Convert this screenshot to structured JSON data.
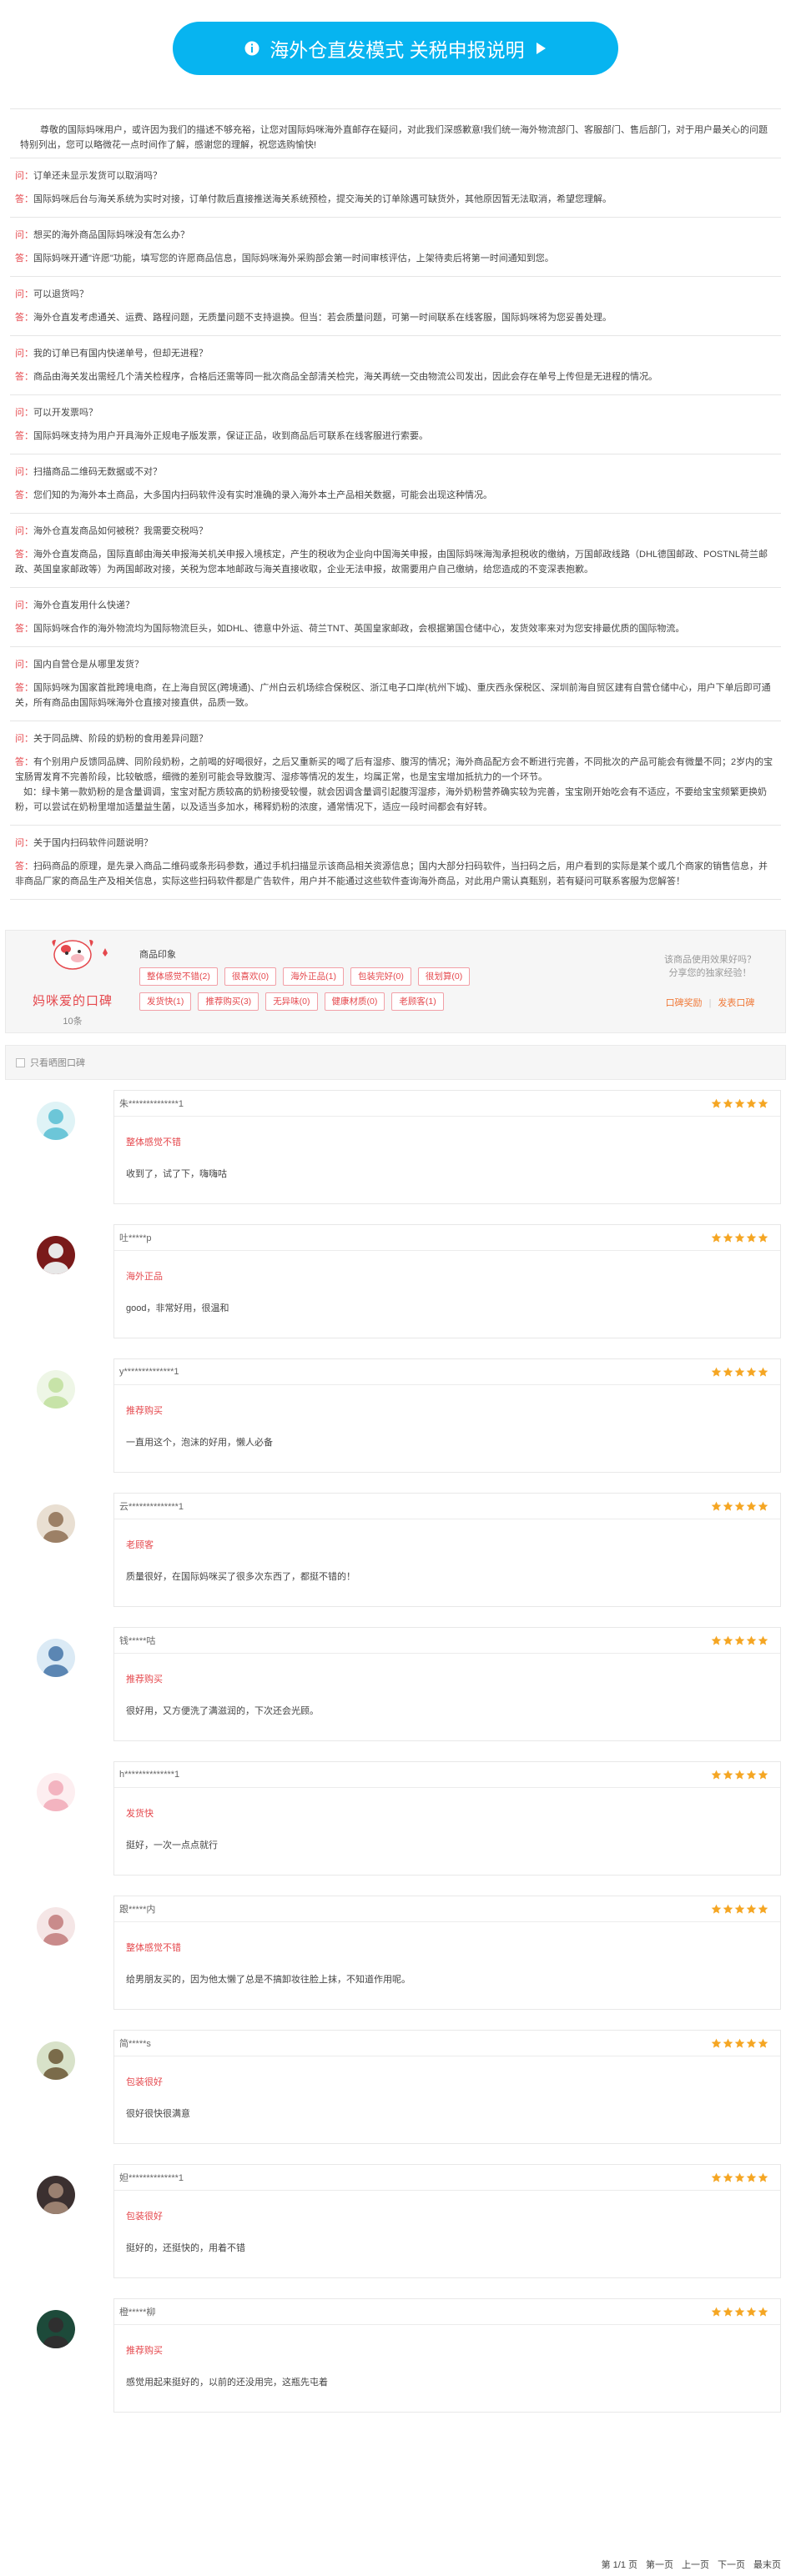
{
  "banner": {
    "title": "海外仓直发模式 关税申报说明"
  },
  "faq": {
    "intro": "尊敬的国际妈咪用户，或许因为我们的描述不够充裕，让您对国际妈咪海外直邮存在疑问，对此我们深感歉意!我们统一海外物流部门、客服部门、售后部门，对于用户最关心的问题特别列出，您可以略微花一点时间作了解，感谢您的理解，祝您选购愉快!",
    "q_tag": "问：",
    "a_tag": "答：",
    "items": [
      {
        "q": "订单还未显示发货可以取消吗？",
        "a": "国际妈咪后台与海关系统为实时对接，订单付款后直接推送海关系统预检，提交海关的订单除遇可缺货外，其他原因暂无法取消，希望您理解。"
      },
      {
        "q": "想买的海外商品国际妈咪没有怎么办？",
        "a": "国际妈咪开通\"许愿\"功能，填写您的许愿商品信息，国际妈咪海外采购部会第一时间审核评估，上架待卖后将第一时间通知到您。"
      },
      {
        "q": "可以退货吗？",
        "a": "海外仓直发考虑通关、运费、路程问题，无质量问题不支持退换。但当：若会质量问题，可第一时间联系在线客服，国际妈咪将为您妥善处理。"
      },
      {
        "q": "我的订单已有国内快递单号，但却无进程？",
        "a": "商品由海关发出需经几个清关检程序，合格后还需等同一批次商品全部清关检完，海关再统一交由物流公司发出，因此会存在单号上传但是无进程的情况。"
      },
      {
        "q": "可以开发票吗？",
        "a": "国际妈咪支持为用户开具海外正规电子版发票，保证正品，收到商品后可联系在线客服进行索要。"
      },
      {
        "q": "扫描商品二维码无数据或不对？",
        "a": "您们知的为海外本土商品，大多国内扫码软件没有实时准确的录入海外本土产品相关数据，可能会出现这种情况。"
      },
      {
        "q": "海外仓直发商品如何被税？我需要交税吗？",
        "a": "海外仓直发商品，国际直邮由海关申报海关机关申报入境核定，产生的税收为企业向中国海关申报，由国际妈咪海淘承担税收的缴纳，万国邮政线路（DHL德国邮政、POSTNL荷兰邮政、英国皇家邮政等）为两国邮政对接，关税为您本地邮政与海关直接收取，企业无法申报，故需要用户自己缴纳，给您造成的不变深表抱歉。"
      },
      {
        "q": "海外仓直发用什么快递？",
        "a": "国际妈咪合作的海外物流均为国际物流巨头，如DHL、德意中外运、荷兰TNT、英国皇家邮政，会根据第国仓储中心，发货效率来对为您安排最优质的国际物流。"
      },
      {
        "q": "国内自营仓是从哪里发货？",
        "a": "国际妈咪为国家首批跨境电商，在上海自贸区(跨境通)、广州白云机场综合保税区、浙江电子口岸(杭州下城)、重庆西永保税区、深圳前海自贸区建有自营仓储中心，用户下单后即可通关，所有商品由国际妈咪海外仓直接对接直供，品质一致。"
      },
      {
        "q": "关于同品牌、阶段的奶粉的食用差异问题？",
        "a_lines": [
          "有个别用户反馈同品牌、同阶段奶粉，之前喝的好喝很好，之后又重新买的喝了后有湿疹、腹泻的情况；海外商品配方会不断进行完善，不同批次的产品可能会有微量不同；2岁内的宝宝肠胃发育不完善阶段，比较敏感，细微的差别可能会导致腹泻、湿疹等情况的发生，均属正常，也是宝宝增加抵抗力的一个环节。",
          "如：绿卡第一款奶粉的是含量调调，宝宝对配方质较高的奶粉接受较慢，就会因调含量调引起腹泻湿疹，海外奶粉营养确实较为完善，宝宝刚开始吃会有不适应，不要给宝宝频繁更换奶粉，可以尝试在奶粉里增加适量益生菌，以及适当多加水，稀释奶粉的浓度，通常情况下，适应一段时间都会有好转。"
        ]
      },
      {
        "q": "关于国内扫码软件问题说明？",
        "a": "扫码商品的原理，是先录入商品二维码或条形码参数，通过手机扫描显示该商品相关资源信息；国内大部分扫码软件，当扫码之后，用户看到的实际是某个或几个商家的销售信息，并非商品厂家的商品生产及相关信息，实际这些扫码软件都是广告软件，用户并不能通过这些软件查询海外商品，对此用户需认真甄别，若有疑问可联系客服为您解答！"
      }
    ]
  },
  "summary": {
    "logo_text": "妈咪爱的口碑",
    "count": "10条",
    "impressions_title": "商品印象",
    "chips": [
      "整体感觉不错(2)",
      "很喜欢(0)",
      "海外正品(1)",
      "包装完好(0)",
      "很划算(0)",
      "发货快(1)",
      "推荐购买(3)",
      "无异味(0)",
      "健康材质(0)",
      "老顾客(1)"
    ],
    "side_line1": "该商品使用效果好吗？",
    "side_line2": "分享您的独家经验！",
    "link_review": "口碑奖励",
    "link_sep": "|",
    "link_post": "发表口碑"
  },
  "filter": {
    "label": "只看晒图口碑"
  },
  "reviews": [
    {
      "user": "朱**************1",
      "tag": "整体感觉不错",
      "text": "收到了，试了下，嗨嗨咕"
    },
    {
      "user": "吐*****p",
      "tag": "海外正品",
      "text": "good，非常好用，很温和"
    },
    {
      "user": "y**************1",
      "tag": "推荐购买",
      "text": "一直用这个，泡沫的好用，懒人必备"
    },
    {
      "user": "云**************1",
      "tag": "老顾客",
      "text": "质量很好，在国际妈咪买了很多次东西了，都挺不错的！"
    },
    {
      "user": "钱*****咕",
      "tag": "推荐购买",
      "text": "很好用，又方便洗了满滋润的，下次还会光顾。"
    },
    {
      "user": "h**************1",
      "tag": "发货快",
      "text": "挺好，一次一点点就行"
    },
    {
      "user": "跟*****内",
      "tag": "整体感觉不错",
      "text": "给男朋友买的，因为他太懒了总是不搞卸妆往脸上抹，不知道作用呢。"
    },
    {
      "user": "简*****s",
      "tag": "包装很好",
      "text": "很好很快很满意"
    },
    {
      "user": "妲**************1",
      "tag": "包装很好",
      "text": "挺好的，还挺快的，用着不错"
    },
    {
      "user": "橙*****柳",
      "tag": "推荐购买",
      "text": "感觉用起来挺好的，以前的还没用完，这瓶先屯着"
    }
  ],
  "pager": {
    "info": "第 1/1 页",
    "first": "第一页",
    "prev": "上一页",
    "next": "下一页",
    "last": "最末页"
  },
  "colors": {
    "banner": "#07b4f0",
    "tag_red": "#e5484d",
    "star": "#f5a623"
  }
}
